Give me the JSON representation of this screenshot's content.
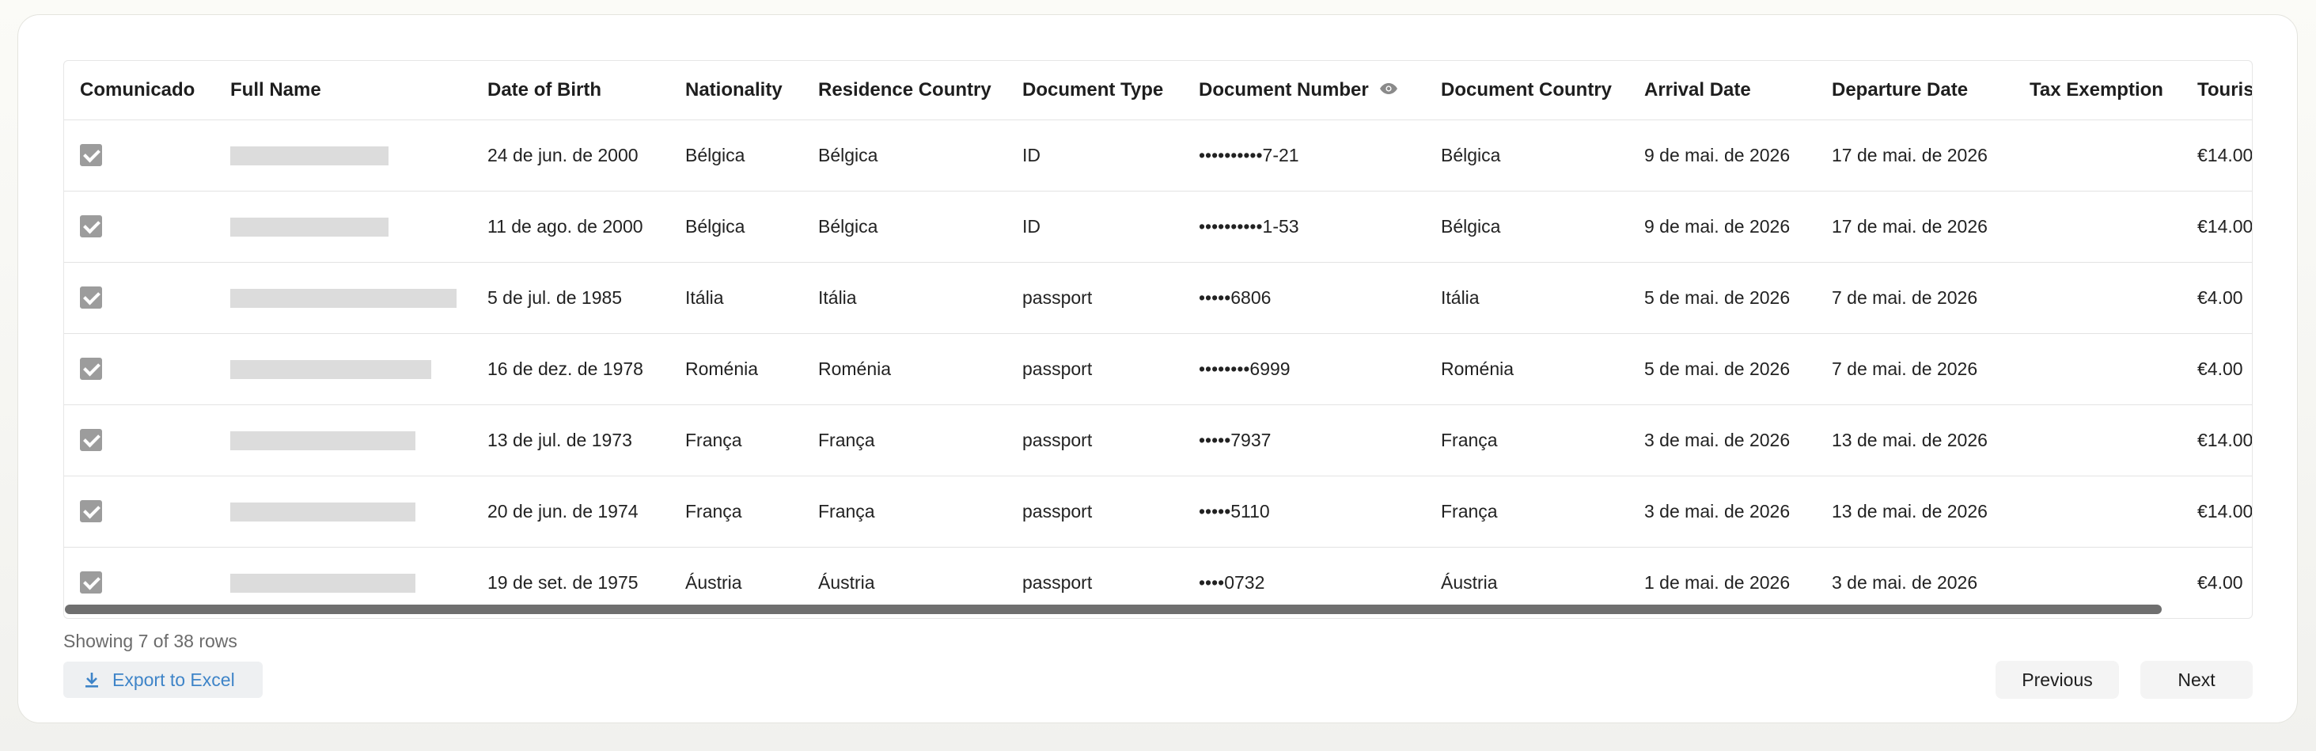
{
  "table": {
    "headers": {
      "comunicado": "Comunicado",
      "full_name": "Full Name",
      "dob": "Date of Birth",
      "nationality": "Nationality",
      "residence": "Residence Country",
      "doc_type": "Document Type",
      "doc_number": "Document Number",
      "doc_country": "Document Country",
      "arrival": "Arrival Date",
      "departure": "Departure Date",
      "tax_exemption": "Tax Exemption",
      "tourist_tax": "Tourist Tax"
    },
    "rows": [
      {
        "dob": "24 de jun. de 2000",
        "nationality": "Bélgica",
        "residence": "Bélgica",
        "doc_type": "ID",
        "doc_number": "••••••••••7-21",
        "doc_country": "Bélgica",
        "arrival": "9 de mai. de 2026",
        "departure": "17 de mai. de 2026",
        "tax_exemption": "",
        "tourist_tax": "€14.00"
      },
      {
        "dob": "11 de ago. de 2000",
        "nationality": "Bélgica",
        "residence": "Bélgica",
        "doc_type": "ID",
        "doc_number": "••••••••••1-53",
        "doc_country": "Bélgica",
        "arrival": "9 de mai. de 2026",
        "departure": "17 de mai. de 2026",
        "tax_exemption": "",
        "tourist_tax": "€14.00"
      },
      {
        "dob": "5 de jul. de 1985",
        "nationality": "Itália",
        "residence": "Itália",
        "doc_type": "passport",
        "doc_number": "•••••6806",
        "doc_country": "Itália",
        "arrival": "5 de mai. de 2026",
        "departure": "7 de mai. de 2026",
        "tax_exemption": "",
        "tourist_tax": "€4.00"
      },
      {
        "dob": "16 de dez. de 1978",
        "nationality": "Roménia",
        "residence": "Roménia",
        "doc_type": "passport",
        "doc_number": "••••••••6999",
        "doc_country": "Roménia",
        "arrival": "5 de mai. de 2026",
        "departure": "7 de mai. de 2026",
        "tax_exemption": "",
        "tourist_tax": "€4.00"
      },
      {
        "dob": "13 de jul. de 1973",
        "nationality": "França",
        "residence": "França",
        "doc_type": "passport",
        "doc_number": "•••••7937",
        "doc_country": "França",
        "arrival": "3 de mai. de 2026",
        "departure": "13 de mai. de 2026",
        "tax_exemption": "",
        "tourist_tax": "€14.00"
      },
      {
        "dob": "20 de jun. de 1974",
        "nationality": "França",
        "residence": "França",
        "doc_type": "passport",
        "doc_number": "•••••5110",
        "doc_country": "França",
        "arrival": "3 de mai. de 2026",
        "departure": "13 de mai. de 2026",
        "tax_exemption": "",
        "tourist_tax": "€14.00"
      },
      {
        "dob": "19 de set. de 1975",
        "nationality": "Áustria",
        "residence": "Áustria",
        "doc_type": "passport",
        "doc_number": "••••0732",
        "doc_country": "Áustria",
        "arrival": "1 de mai. de 2026",
        "departure": "3 de mai. de 2026",
        "tax_exemption": "",
        "tourist_tax": "€4.00"
      }
    ]
  },
  "footer": {
    "rows_info": "Showing 7 of 38 rows",
    "export_label": "Export to Excel",
    "previous_label": "Previous",
    "next_label": "Next"
  },
  "colors": {
    "accent": "#3e84c8",
    "checkbox": "#9c9c9c"
  }
}
